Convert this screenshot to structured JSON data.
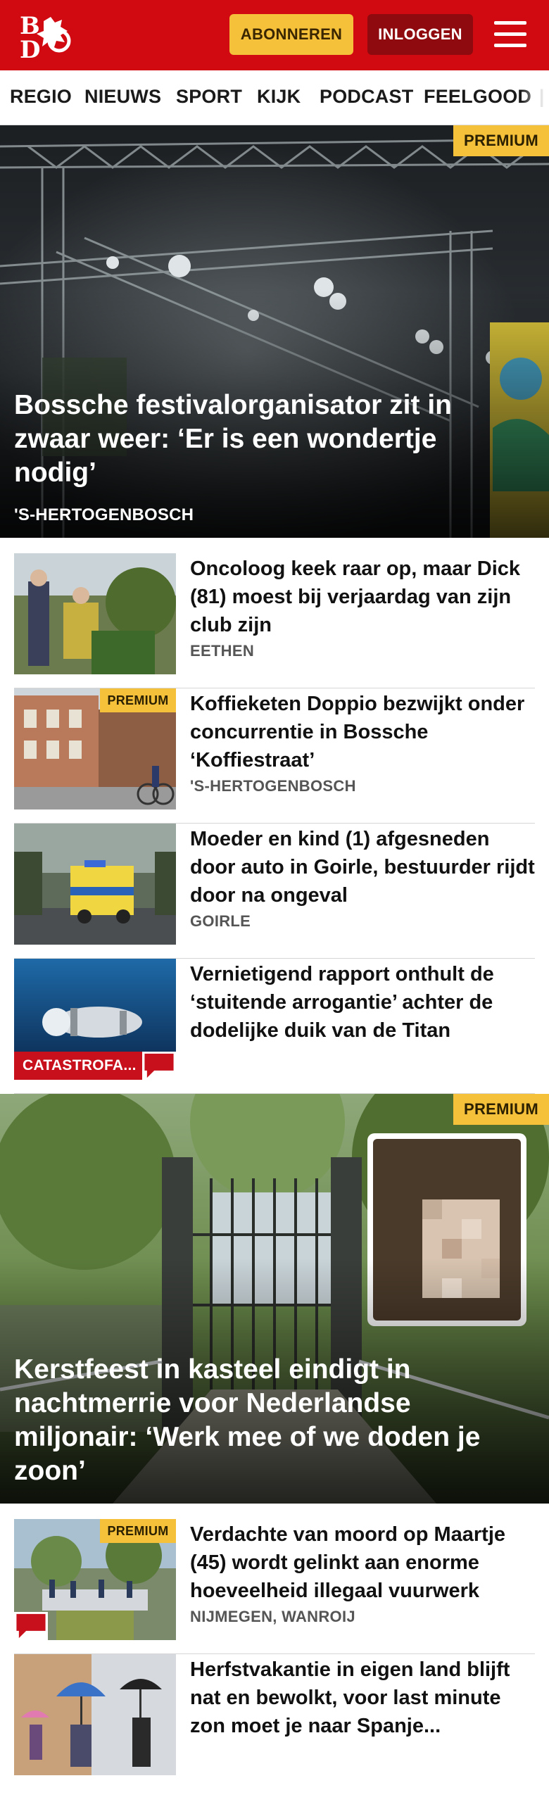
{
  "header": {
    "logo_text": "BD",
    "subscribe_label": "ABONNEREN",
    "login_label": "INLOGGEN",
    "brand_color": "#d10a11"
  },
  "nav": {
    "items": [
      "REGIO",
      "NIEUWS",
      "SPORT",
      "KIJK",
      "PODCAST",
      "FEELGOOD"
    ]
  },
  "hero1": {
    "badge": "PREMIUM",
    "title": "Bossche festivalorganisator zit in zwaar weer: ‘Er is een wondertje nodig’",
    "location": "'S-HERTOGENBOSCH"
  },
  "articles": [
    {
      "title": "Oncoloog keek raar op, maar Dick (81) moest bij verjaardag van zijn club zijn",
      "location": "EETHEN"
    },
    {
      "badge": "PREMIUM",
      "title": "Koffieketen Doppio bezwijkt onder concurrentie in Bossche ‘Koffiestraat’",
      "location": "'S-HERTOGENBOSCH"
    },
    {
      "title": "Moeder en kind (1) afgesneden door auto in Goirle, bestuurder rijdt door na ongeval",
      "location": "GOIRLE"
    },
    {
      "title": "Vernietigend rapport onthult de ‘stuitende arrogantie’ achter de dodelijke duik van de Titan",
      "category": "CATASTROFA..."
    }
  ],
  "hero2": {
    "badge": "PREMIUM",
    "title": "Kerstfeest in kasteel eindigt in nachtmerrie voor Nederlandse miljonair: ‘Werk mee of we doden je zoon’"
  },
  "articles2": [
    {
      "badge": "PREMIUM",
      "title": "Verdachte van moord op Maartje (45) wordt gelinkt aan enorme hoeveelheid illegaal vuurwerk",
      "location": "NIJMEGEN, WANROIJ"
    },
    {
      "title": "Herfstvakantie in eigen land blijft nat en bewolkt, voor last minute zon moet je naar Spanje..."
    }
  ],
  "colors": {
    "accent_red": "#d10a11",
    "premium_yellow": "#f5c03a",
    "login_dark_red": "#8e0a0f",
    "category_red": "#c8101c"
  }
}
